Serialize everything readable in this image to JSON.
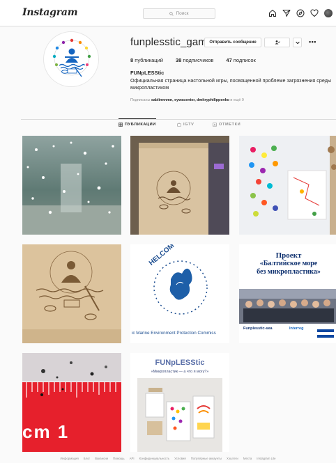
{
  "nav": {
    "logo": "Instagram",
    "search_placeholder": "Поиск",
    "icons": [
      "home-icon",
      "direct-icon",
      "explore-icon",
      "heart-icon",
      "avatar"
    ]
  },
  "profile": {
    "username": "funplesstic_game",
    "message_button": "Отправить сообщение",
    "stats": {
      "posts_num": "8",
      "posts_label": "публикаций",
      "followers_num": "38",
      "followers_label": "подписчиков",
      "following_num": "47",
      "following_label": "подписок"
    },
    "full_name": "FUNpLESStic",
    "bio": "Официальная страница настольной игры, посвященной проблеме загрязнения среды микропластиком",
    "followed_by_prefix": "Подписаны",
    "followed_by_users": "sablinnnmn, eywacenter, dmitryphilippenko",
    "followed_by_suffix": "и ещё 9"
  },
  "tabs": [
    {
      "label": "ПУБЛИКАЦИИ",
      "icon": "grid-icon",
      "active": true
    },
    {
      "label": "IGTV",
      "icon": "igtv-icon",
      "active": false
    },
    {
      "label": "ОТМЕТКИ",
      "icon": "tag-icon",
      "active": false
    }
  ],
  "posts": [
    {
      "description": "water splash"
    },
    {
      "description": "wooden board with logo"
    },
    {
      "description": "game board cards"
    },
    {
      "description": "wooden logo plate"
    },
    {
      "description": "HELCOM logo",
      "logo_text": "HELCOM",
      "caption": "ic Marine Environment Protection Commiss"
    },
    {
      "description": "project slide",
      "title_line1": "Проект",
      "title_line2": "«Балтийское море",
      "title_line3": "без микропластика»",
      "brand": "Funplesstic-sea",
      "partner": "Interreg"
    },
    {
      "description": "microplastic ruler",
      "ruler_text": "cm 1"
    },
    {
      "description": "game components",
      "title": "FUNpLESStic",
      "subtitle": "«Микропластик — а что я могу?»"
    }
  ],
  "footer": [
    "Информация",
    "Блог",
    "Вакансии",
    "Помощь",
    "API",
    "Конфиденциальность",
    "Условия",
    "Популярные аккаунты",
    "Хэштеги",
    "Места",
    "Instagram Lite"
  ]
}
